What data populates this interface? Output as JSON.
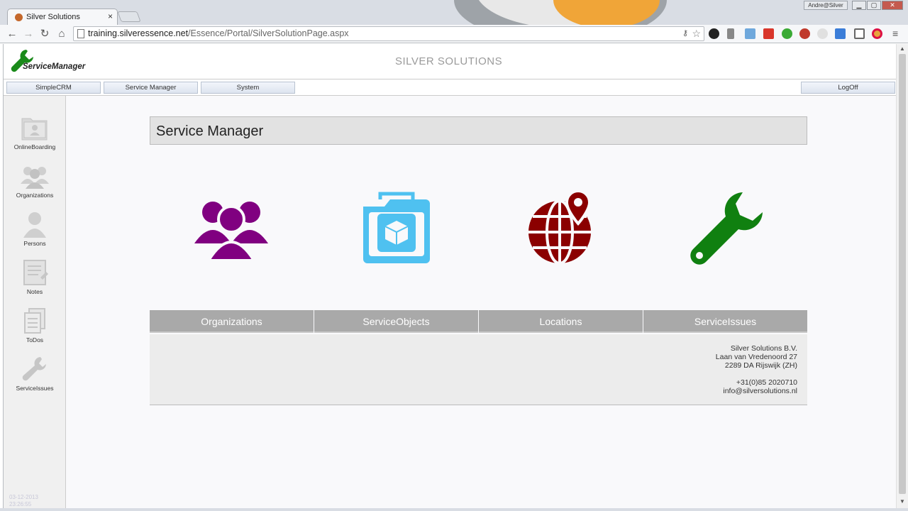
{
  "browser": {
    "tab_title": "Silver Solutions",
    "tab_close": "×",
    "user_badge": "Andre@Silver",
    "url_host": "training.silveressence.net",
    "url_path": "/Essence/Portal/SilverSolutionPage.aspx"
  },
  "header": {
    "logo_text": "ServiceManager",
    "site_title": "SILVER SOLUTIONS"
  },
  "menu": {
    "items": [
      "SimpleCRM",
      "Service Manager",
      "System"
    ],
    "logoff": "LogOff"
  },
  "sidebar": {
    "items": [
      {
        "label": "OnlineBoarding",
        "icon": "folder-person-icon"
      },
      {
        "label": "Organizations",
        "icon": "people-group-icon"
      },
      {
        "label": "Persons",
        "icon": "person-icon"
      },
      {
        "label": "Notes",
        "icon": "notes-icon"
      },
      {
        "label": "ToDos",
        "icon": "todos-icon"
      },
      {
        "label": "ServiceIssues",
        "icon": "wrench-icon"
      }
    ],
    "stamp_date": "03-12-2013",
    "stamp_time": "23:26:55"
  },
  "main": {
    "title": "Service Manager",
    "categories": [
      {
        "label": "Organizations",
        "icon": "people-group-icon",
        "color": "#800080"
      },
      {
        "label": "ServiceObjects",
        "icon": "box-folder-icon",
        "color": "#4fc1f0"
      },
      {
        "label": "Locations",
        "icon": "globe-pin-icon",
        "color": "#8b0000"
      },
      {
        "label": "ServiceIssues",
        "icon": "wrench-icon",
        "color": "#108010"
      }
    ],
    "company": {
      "name": "Silver Solutions B.V.",
      "street": "Laan van Vredenoord 27",
      "city": "2289 DA Rijswijk (ZH)",
      "phone": "+31(0)85 2020710",
      "email": "info@silversolutions.nl"
    }
  }
}
